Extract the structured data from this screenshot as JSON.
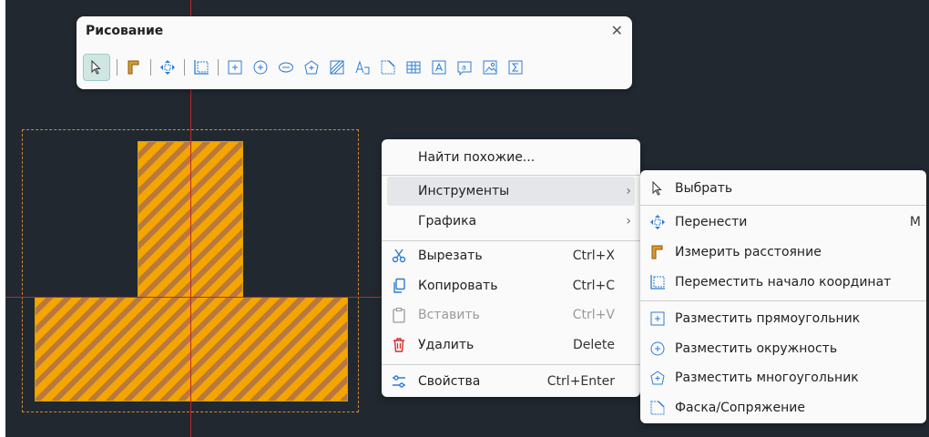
{
  "toolbar": {
    "title": "Рисование",
    "close_icon": "close-icon",
    "tools": [
      "select-arrow-icon",
      "measure-icon",
      "move-icon",
      "move-origin-icon",
      "rectangle-icon",
      "circle-icon",
      "ellipse-icon",
      "polygon-icon",
      "hatch-icon",
      "text-curve-icon",
      "chamfer-icon",
      "table-icon",
      "text-box-icon",
      "label-icon",
      "image-icon",
      "formula-icon"
    ]
  },
  "context_menu": {
    "find_similar": "Найти похожие...",
    "tools": "Инструменты",
    "graphics": "Графика",
    "cut": "Вырезать",
    "cut_shortcut": "Ctrl+X",
    "copy": "Копировать",
    "copy_shortcut": "Ctrl+C",
    "paste": "Вставить",
    "paste_shortcut": "Ctrl+V",
    "delete": "Удалить",
    "delete_shortcut": "Delete",
    "properties": "Свойства",
    "properties_shortcut": "Ctrl+Enter",
    "submenu_arrow": "›"
  },
  "submenu": {
    "select": "Выбрать",
    "move": "Перенести",
    "move_shortcut": "M",
    "measure": "Измерить расстояние",
    "move_origin": "Переместить начало координат",
    "place_rectangle": "Разместить прямоугольник",
    "place_circle": "Разместить окружность",
    "place_polygon": "Разместить многоугольник",
    "chamfer_fillet": "Фаска/Сопряжение"
  },
  "colors": {
    "canvas": "#212830",
    "shape_fill": "#f5a500",
    "axis": "#c0282b",
    "accent": "#2e7dd1",
    "delete_red": "#d32f2f"
  }
}
